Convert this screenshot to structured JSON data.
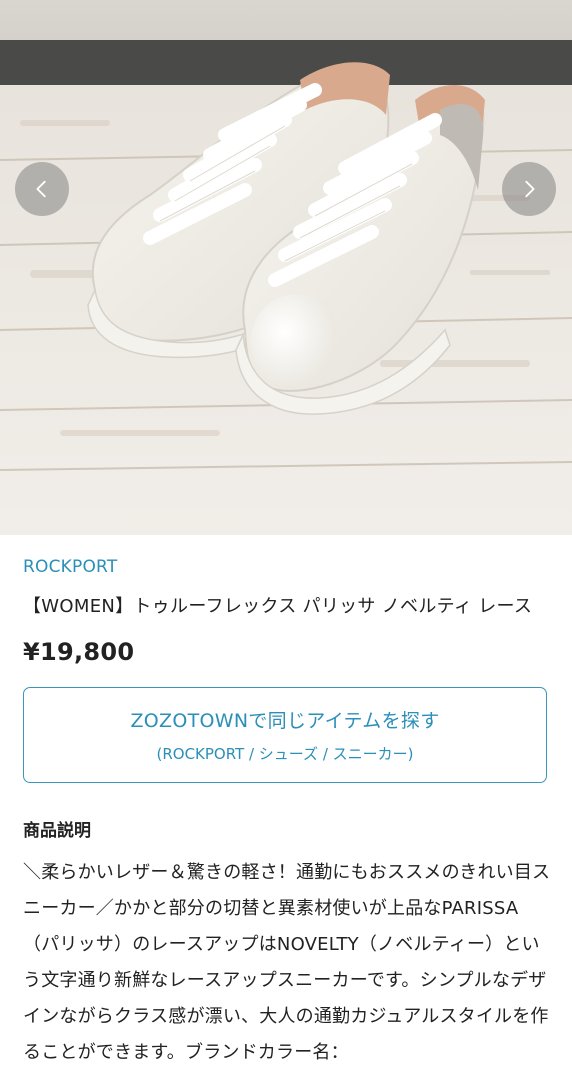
{
  "carousel": {
    "image_alt": "white leather lace-up sneakers on wooden floor",
    "prev_icon": "chevron-left-icon",
    "next_icon": "chevron-right-icon"
  },
  "product": {
    "brand": "ROCKPORT",
    "title": "【WOMEN】トゥルーフレックス パリッサ ノベルティ レース",
    "price": "¥19,800"
  },
  "search_button": {
    "label": "ZOZOTOWNで同じアイテムを探す",
    "sub_label": "(ROCKPORT / シューズ / スニーカー)"
  },
  "description": {
    "heading": "商品説明",
    "body": "＼柔らかいレザー＆驚きの軽さ！通勤にもおススメのきれい目スニーカー／かかと部分の切替と異素材使いが上品なPARISSA（パリッサ）のレースアップはNOVELTY（ノベルティー）という文字通り新鮮なレースアップスニーカーです。シンプルなデザインながらクラス感が漂い、大人の通勤カジュアルスタイルを作ることができます。ブランドカラー名："
  },
  "colors": {
    "accent": "#2b8fb8",
    "text": "#222222",
    "background": "#ffffff"
  }
}
